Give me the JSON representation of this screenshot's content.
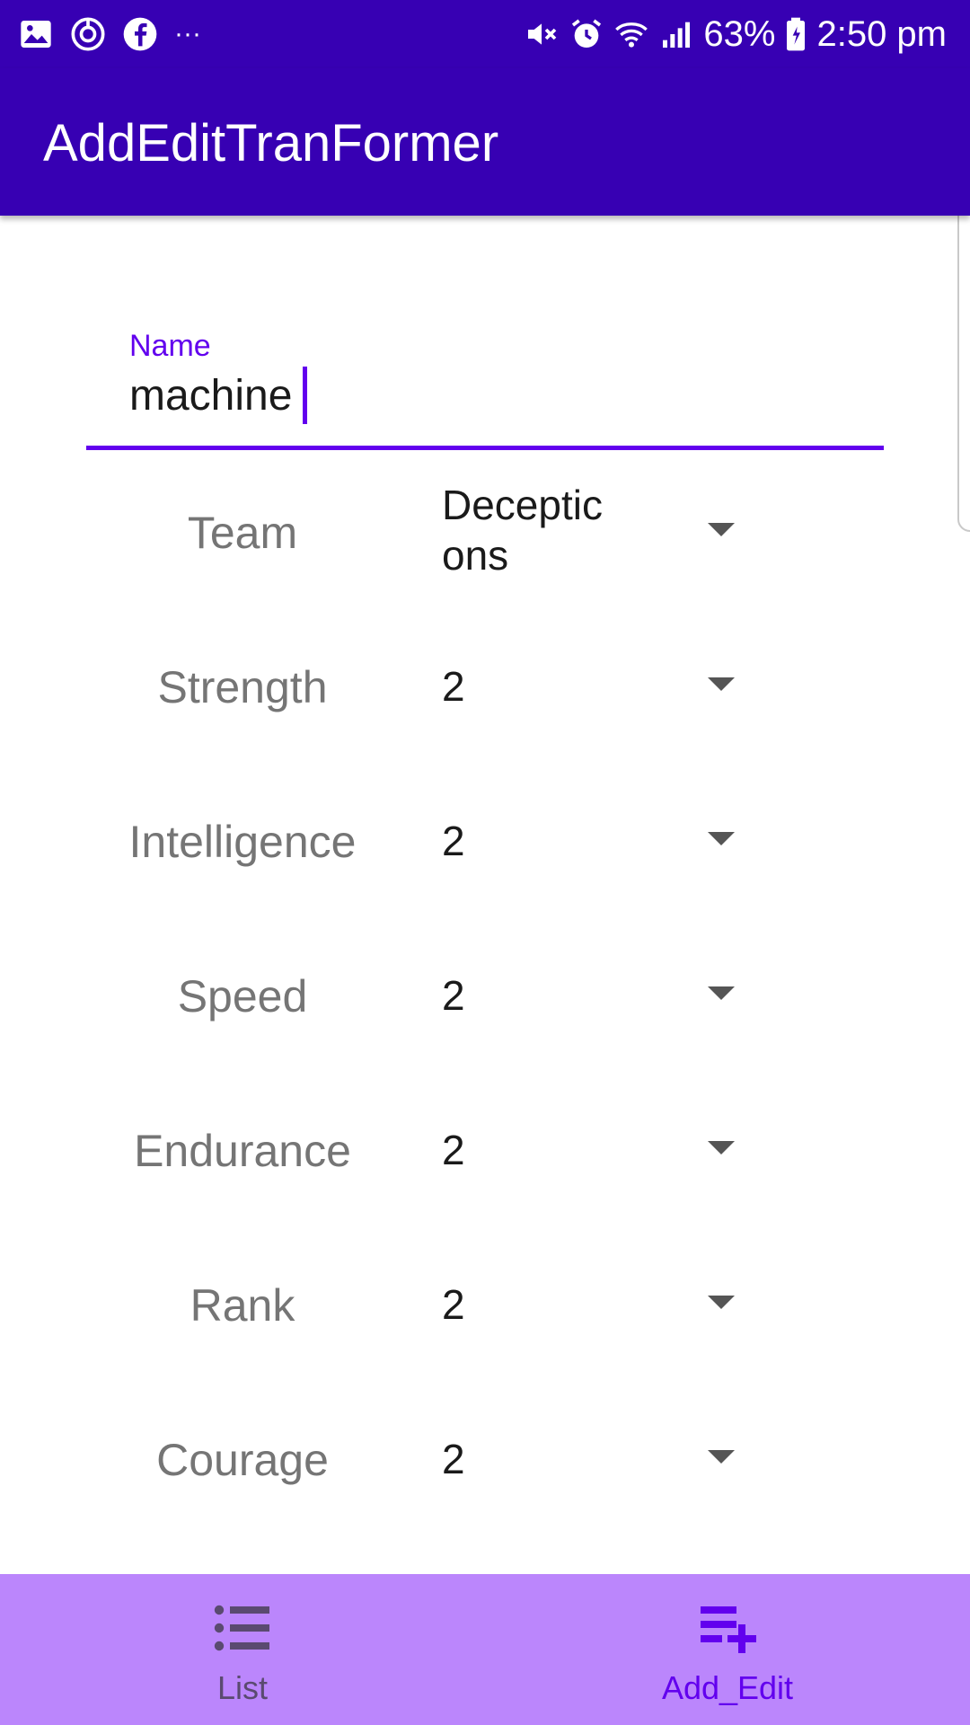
{
  "status_bar": {
    "left_icons": [
      "gallery-icon",
      "sync-icon",
      "facebook-icon",
      "more-dots-icon"
    ],
    "more_dots": "···",
    "right_icons": [
      "mute-icon",
      "alarm-icon",
      "wifi-icon",
      "signal-icon",
      "battery-icon"
    ],
    "battery_percent": "63%",
    "time": "2:50 pm"
  },
  "app_bar": {
    "title": "AddEditTranFormer"
  },
  "form": {
    "name": {
      "label": "Name",
      "value": "machine"
    },
    "rows": [
      {
        "label": "Team",
        "value": "Deceptic\nons"
      },
      {
        "label": "Strength",
        "value": "2"
      },
      {
        "label": "Intelligence",
        "value": "2"
      },
      {
        "label": "Speed",
        "value": "2"
      },
      {
        "label": "Endurance",
        "value": "2"
      },
      {
        "label": "Rank",
        "value": "2"
      },
      {
        "label": "Courage",
        "value": "2"
      }
    ]
  },
  "bottom_nav": {
    "items": [
      {
        "label": "List",
        "icon": "list-icon",
        "selected": false
      },
      {
        "label": "Add_Edit",
        "icon": "playlist-add-icon",
        "selected": true
      }
    ]
  },
  "colors": {
    "primary_dark": "#3700b3",
    "accent": "#6200ee",
    "nav_background": "#bb86fc",
    "nav_unselected": "#5a4a70"
  }
}
